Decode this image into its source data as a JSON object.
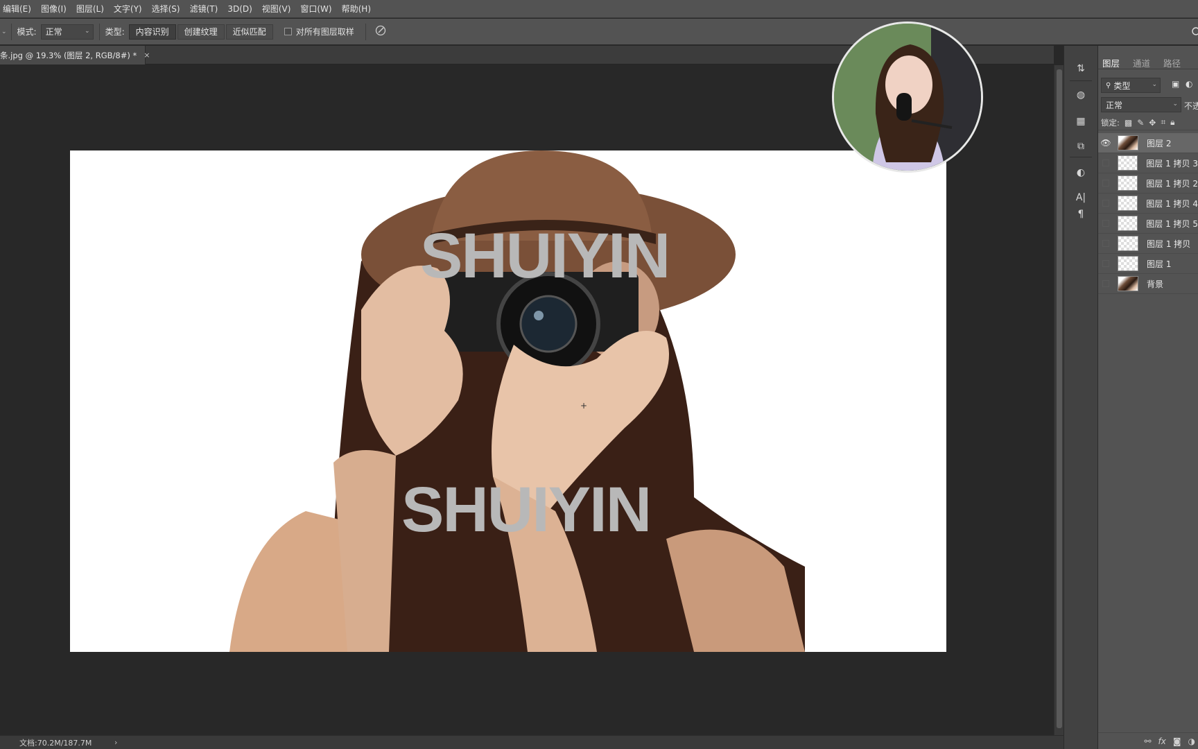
{
  "menu": [
    "编辑(E)",
    "图像(I)",
    "图层(L)",
    "文字(Y)",
    "选择(S)",
    "滤镜(T)",
    "3D(D)",
    "视图(V)",
    "窗口(W)",
    "帮助(H)"
  ],
  "options": {
    "mode_label": "模式:",
    "mode_value": "正常",
    "type_label": "类型:",
    "type_buttons": [
      "内容识别",
      "创建纹理",
      "近似匹配"
    ],
    "sample_all_layers": "对所有图层取样"
  },
  "document": {
    "tab_title": "条.jpg @ 19.3% (图层 2, RGB/8#) *",
    "close": "×"
  },
  "image": {
    "watermark_top": "SHUIYIN",
    "watermark_bottom": "SHUIYIN"
  },
  "status": {
    "doc_size": "文档:70.2M/187.7M",
    "arrow": "›"
  },
  "panel": {
    "tabs": [
      "图层",
      "通道",
      "路径"
    ],
    "filter_label": "类型",
    "blend_mode": "正常",
    "opacity_label": "不透",
    "lock_label": "锁定:",
    "layers": [
      {
        "name": "图层 2",
        "visible": true,
        "selected": true
      },
      {
        "name": "图层 1 拷贝 3",
        "visible": false,
        "selected": false
      },
      {
        "name": "图层 1 拷贝 2",
        "visible": false,
        "selected": false
      },
      {
        "name": "图层 1 拷贝 4",
        "visible": false,
        "selected": false
      },
      {
        "name": "图层 1 拷贝 5",
        "visible": false,
        "selected": false
      },
      {
        "name": "图层 1 拷贝",
        "visible": false,
        "selected": false
      },
      {
        "name": "图层 1",
        "visible": false,
        "selected": false
      },
      {
        "name": "背景",
        "visible": false,
        "selected": false
      }
    ],
    "footer_icons": [
      "link-icon",
      "fx-icon",
      "mask-icon",
      "adjustment-icon"
    ]
  },
  "colors": {
    "accent": "#676767",
    "panel": "#535353",
    "canvas": "#282828"
  }
}
